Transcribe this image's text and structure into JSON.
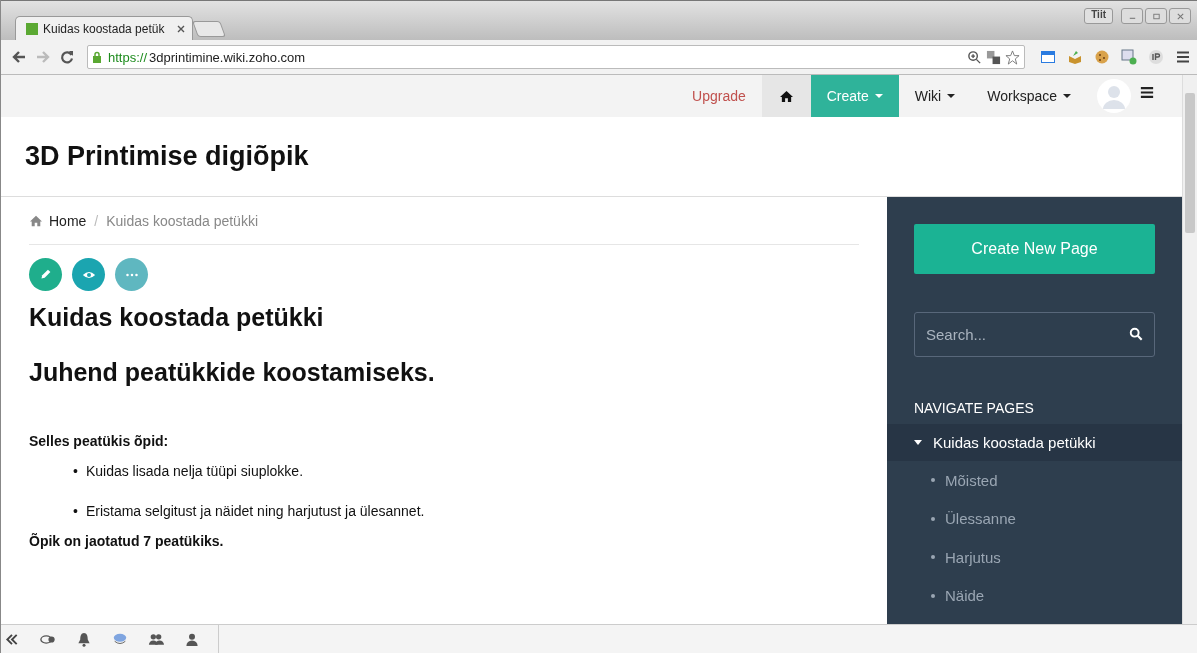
{
  "browser": {
    "tabs": [
      {
        "title": "Kuidas koostada petük",
        "selected": true
      }
    ],
    "url_scheme": "https://",
    "url_host": "3dprintimine.wiki.zoho.com",
    "profile_label": "Tiit"
  },
  "topnav": [
    {
      "kind": "upgrade",
      "label": "Upgrade"
    },
    {
      "kind": "home"
    },
    {
      "kind": "primary",
      "label": "Create"
    },
    {
      "kind": "menu",
      "label": "Wiki"
    },
    {
      "kind": "menu",
      "label": "Workspace"
    }
  ],
  "site_title": "3D Printimise digiõpik",
  "breadcrumb": [
    "Home",
    "Kuidas koostada petükki"
  ],
  "breadcrumb_separator": "/",
  "bullet_marker": "•",
  "page": {
    "title": "Kuidas koostada petükki",
    "subtitle": "Juhend peatükkide koostamiseks.",
    "intro": "Selles peatükis õpid:",
    "bullets": [
      "Kuidas lisada nelja tüüpi siuplokke.",
      "Eristama selgitust ja näidet ning harjutust ja ülesannet."
    ],
    "closing": "Õpik on jaotatud 7 peatükiks."
  },
  "sidebar": {
    "create_button": "Create New Page",
    "search": {
      "placeholder": "Search..."
    },
    "heading": "NAVIGATE PAGES",
    "tree": [
      {
        "label": "Kuidas koostada petükki",
        "selected": true,
        "expanded": true,
        "children": [
          {
            "label": "Mõisted"
          },
          {
            "label": "Ülessanne"
          },
          {
            "label": "Harjutus"
          },
          {
            "label": "Näide"
          }
        ]
      }
    ]
  }
}
